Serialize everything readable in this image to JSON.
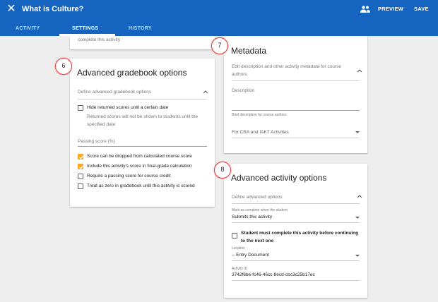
{
  "appbar": {
    "title": "What is Culture?",
    "close_icon": "close-icon",
    "people_icon": "people-icon",
    "preview_label": "PREVIEW",
    "save_label": "SAVE",
    "color": "#1565c0"
  },
  "tabs": [
    {
      "label": "ACTIVITY",
      "active": false
    },
    {
      "label": "SETTINGS",
      "active": true
    },
    {
      "label": "HISTORY",
      "active": false
    }
  ],
  "prev_card": {
    "text": "complete this activity"
  },
  "gradebook": {
    "badge": "6",
    "title": "Advanced gradebook options",
    "define_label": "Define advanced gradebook options",
    "hide_returned": {
      "label": "Hide returned scores until a certain date",
      "checked": false
    },
    "hide_note": "Returned scores will not be shown to students until the specified date",
    "passing_label": "Passing score (%)",
    "options": [
      {
        "label": "Score can be dropped from calculated course score",
        "checked": true
      },
      {
        "label": "Include this activity's score in final-grade calculation",
        "checked": true
      },
      {
        "label": "Require a passing score for course credit",
        "checked": false
      },
      {
        "label": "Treat as zero in gradebook until this activity is scored",
        "checked": false
      }
    ],
    "accent": "#f9a825"
  },
  "metadata": {
    "badge": "7",
    "title": "Metadata",
    "edit_label": "Edit description and other activity metadata for course authors",
    "description_label": "Description",
    "description_hint": "Brief description for course authors",
    "select_value": "For CRA and IAKT Activities"
  },
  "activity": {
    "badge": "8",
    "title": "Advanced activity options",
    "define_label": "Define advanced options",
    "complete_label": "Mark as complete when the student",
    "complete_value": "Submits this activity",
    "must_complete": {
      "label": "Student must complete this activity before continuing to the next one",
      "checked": false
    },
    "location_label": "Location",
    "location_value": "-- Entry Document",
    "activity_id_label": "Activity ID",
    "activity_id_value": "3742f6be-fc46-46cc-8ecd-cbc3c25b17ec"
  },
  "badge_color": "#e53935"
}
